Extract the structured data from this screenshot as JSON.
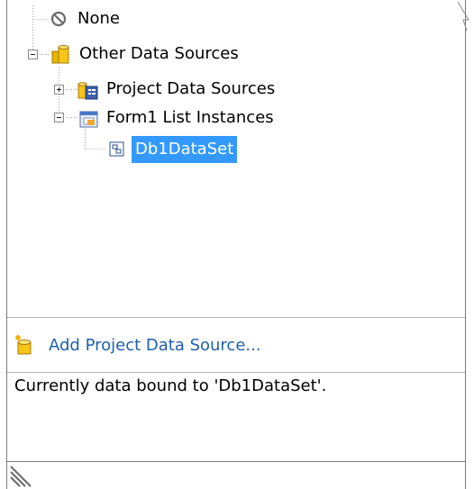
{
  "tree": {
    "items": [
      {
        "label": "None",
        "icon": "none-icon"
      },
      {
        "label": "Other Data Sources",
        "icon": "database-icon"
      },
      {
        "label": "Project Data Sources",
        "icon": "project-datasource-icon"
      },
      {
        "label": "Form1 List Instances",
        "icon": "form-icon"
      },
      {
        "label": "Db1DataSet",
        "icon": "dataset-icon"
      }
    ],
    "selected": "Db1DataSet"
  },
  "add_link": {
    "label": "Add Project Data Source...",
    "icon": "add-datasource-icon"
  },
  "status": {
    "text": "Currently data bound to 'Db1DataSet'."
  },
  "colors": {
    "selection": "#3399ff",
    "link": "#1f5fb0",
    "folder": "#e8b400"
  }
}
